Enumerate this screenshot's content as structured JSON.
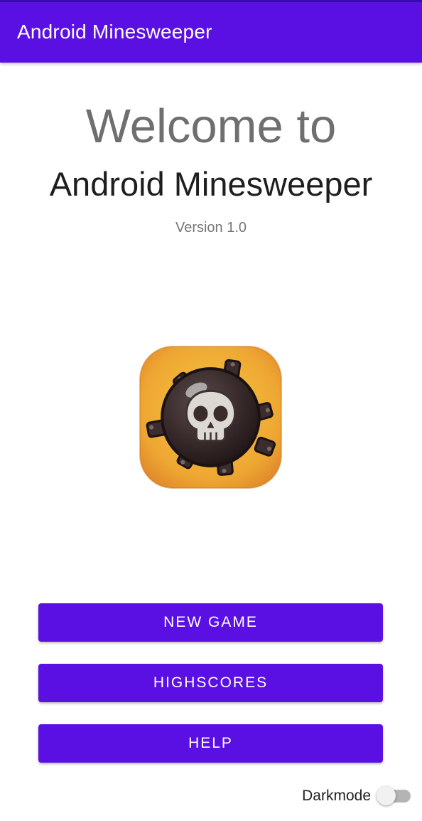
{
  "app_bar": {
    "title": "Android Minesweeper",
    "color": "#5b10e3"
  },
  "main": {
    "welcome": "Welcome to",
    "app_name": "Android Minesweeper",
    "version": "Version 1.0",
    "logo_icon": "skull-mine-icon"
  },
  "buttons": {
    "new_game": "NEW GAME",
    "highscores": "HIGHSCORES",
    "help": "HELP"
  },
  "darkmode": {
    "label": "Darkmode",
    "enabled": false
  }
}
